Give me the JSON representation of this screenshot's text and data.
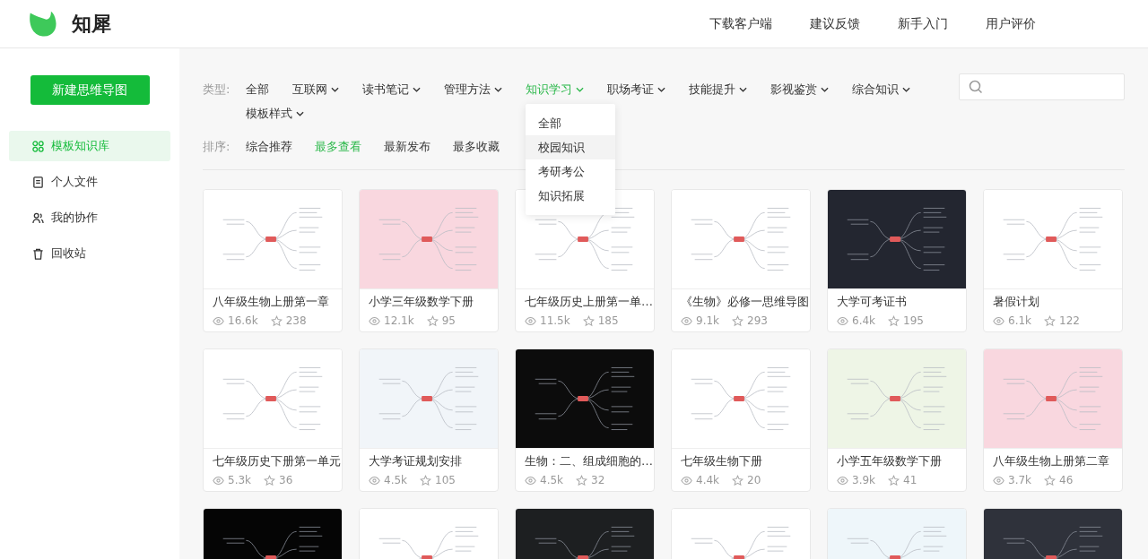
{
  "brand": {
    "name": "知犀"
  },
  "nav": [
    "下载客户端",
    "建议反馈",
    "新手入门",
    "用户评价"
  ],
  "sidebar": {
    "new_button": "新建思维导图",
    "items": [
      {
        "label": "模板知识库",
        "kind": "library",
        "selected": true
      },
      {
        "label": "个人文件",
        "kind": "files",
        "selected": false
      },
      {
        "label": "我的协作",
        "kind": "team",
        "selected": false
      },
      {
        "label": "回收站",
        "kind": "bin",
        "selected": false
      }
    ]
  },
  "filters": {
    "type_label": "类型:",
    "types": [
      {
        "label": "全部",
        "dropdown": false,
        "selected": false
      },
      {
        "label": "互联网",
        "dropdown": true,
        "selected": false
      },
      {
        "label": "读书笔记",
        "dropdown": true,
        "selected": false
      },
      {
        "label": "管理方法",
        "dropdown": true,
        "selected": false
      },
      {
        "label": "知识学习",
        "dropdown": true,
        "selected": true,
        "menu": [
          {
            "label": "全部",
            "highlighted": false
          },
          {
            "label": "校园知识",
            "highlighted": true
          },
          {
            "label": "考研考公",
            "highlighted": false
          },
          {
            "label": "知识拓展",
            "highlighted": false
          }
        ]
      },
      {
        "label": "职场考证",
        "dropdown": true,
        "selected": false
      },
      {
        "label": "技能提升",
        "dropdown": true,
        "selected": false
      },
      {
        "label": "影视鉴赏",
        "dropdown": true,
        "selected": false
      },
      {
        "label": "综合知识",
        "dropdown": true,
        "selected": false
      },
      {
        "label": "模板样式",
        "dropdown": true,
        "selected": false
      }
    ],
    "sort_label": "排序:",
    "sorts": [
      {
        "label": "综合推荐",
        "selected": false
      },
      {
        "label": "最多查看",
        "selected": true
      },
      {
        "label": "最新发布",
        "selected": false
      },
      {
        "label": "最多收藏",
        "selected": false
      }
    ]
  },
  "cards": [
    {
      "title": "八年级生物上册第一章",
      "views": "16.6k",
      "stars": "238",
      "color": "#ffffff"
    },
    {
      "title": "小学三年级数学下册",
      "views": "12.1k",
      "stars": "95",
      "color": "#f9d7df"
    },
    {
      "title": "七年级历史上册第一单…",
      "views": "11.5k",
      "stars": "185",
      "color": "#ffffff"
    },
    {
      "title": "《生物》必修一思维导图",
      "views": "9.1k",
      "stars": "293",
      "color": "#ffffff"
    },
    {
      "title": "大学可考证书",
      "views": "6.4k",
      "stars": "195",
      "color": "#232630"
    },
    {
      "title": "暑假计划",
      "views": "6.1k",
      "stars": "122",
      "color": "#ffffff"
    },
    {
      "title": "七年级历史下册第一单元",
      "views": "5.3k",
      "stars": "36",
      "color": "#ffffff"
    },
    {
      "title": "大学考证规划安排",
      "views": "4.5k",
      "stars": "105",
      "color": "#f1f5f9"
    },
    {
      "title": "生物：二、组成细胞的…",
      "views": "4.5k",
      "stars": "32",
      "color": "#0c0c0c"
    },
    {
      "title": "七年级生物下册",
      "views": "4.4k",
      "stars": "20",
      "color": "#ffffff"
    },
    {
      "title": "小学五年级数学下册",
      "views": "3.9k",
      "stars": "41",
      "color": "#eef5e6"
    },
    {
      "title": "八年级生物上册第二章",
      "views": "3.7k",
      "stars": "46",
      "color": "#f9d7df"
    },
    {
      "color": "#050505"
    },
    {
      "color": "#ffffff"
    },
    {
      "color": "#1d1f21"
    },
    {
      "color": "#ffffff"
    },
    {
      "color": "#eef6fa"
    },
    {
      "color": "#2f323b"
    }
  ]
}
